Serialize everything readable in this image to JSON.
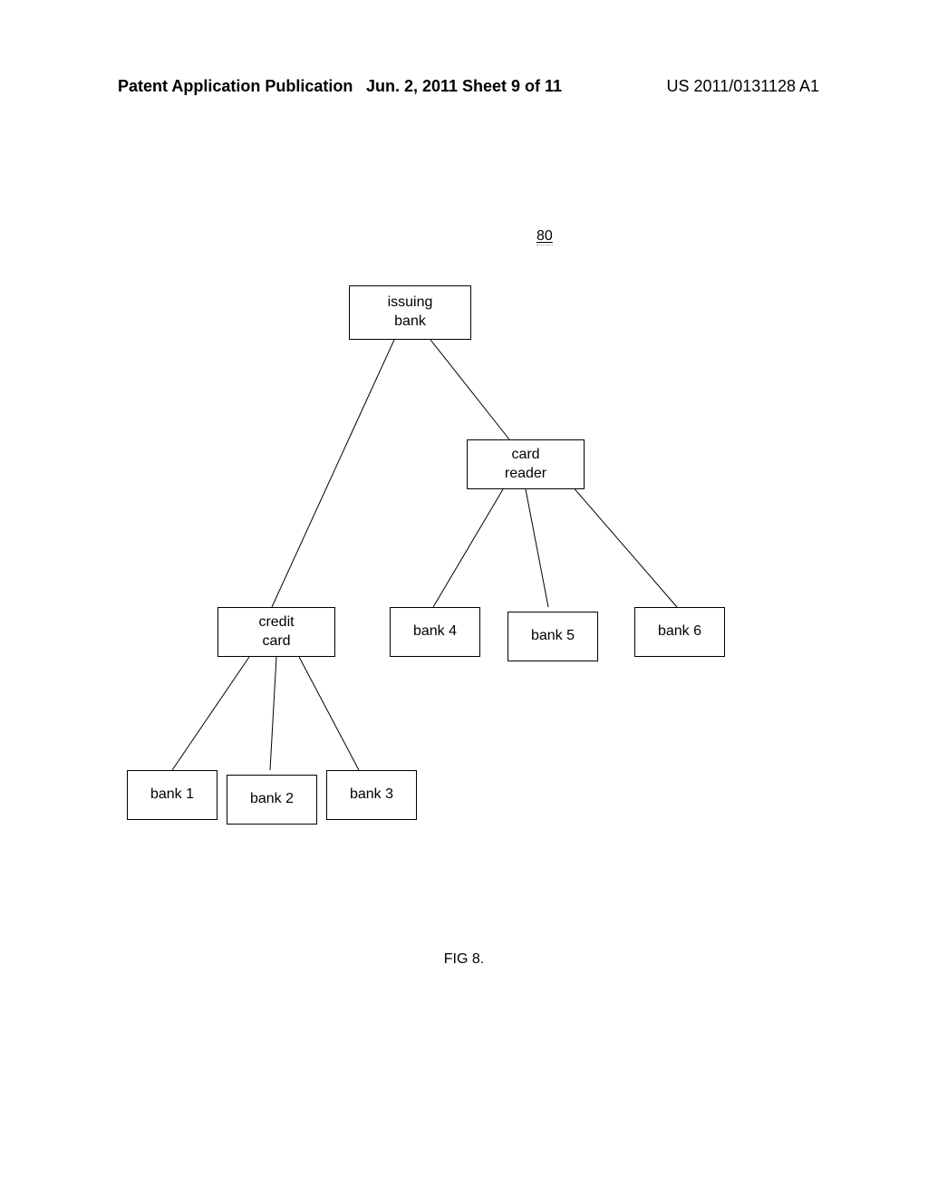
{
  "header": {
    "left": "Patent Application Publication",
    "center": "Jun. 2, 2011  Sheet 9 of 11",
    "right": "US 2011/0131128 A1"
  },
  "diagram_id": "80",
  "nodes": {
    "issuing_bank": "issuing\nbank",
    "card_reader": "card\nreader",
    "credit_card": "credit\ncard",
    "bank1": "bank 1",
    "bank2": "bank 2",
    "bank3": "bank 3",
    "bank4": "bank 4",
    "bank5": "bank 5",
    "bank6": "bank 6"
  },
  "figure_caption": "FIG 8."
}
